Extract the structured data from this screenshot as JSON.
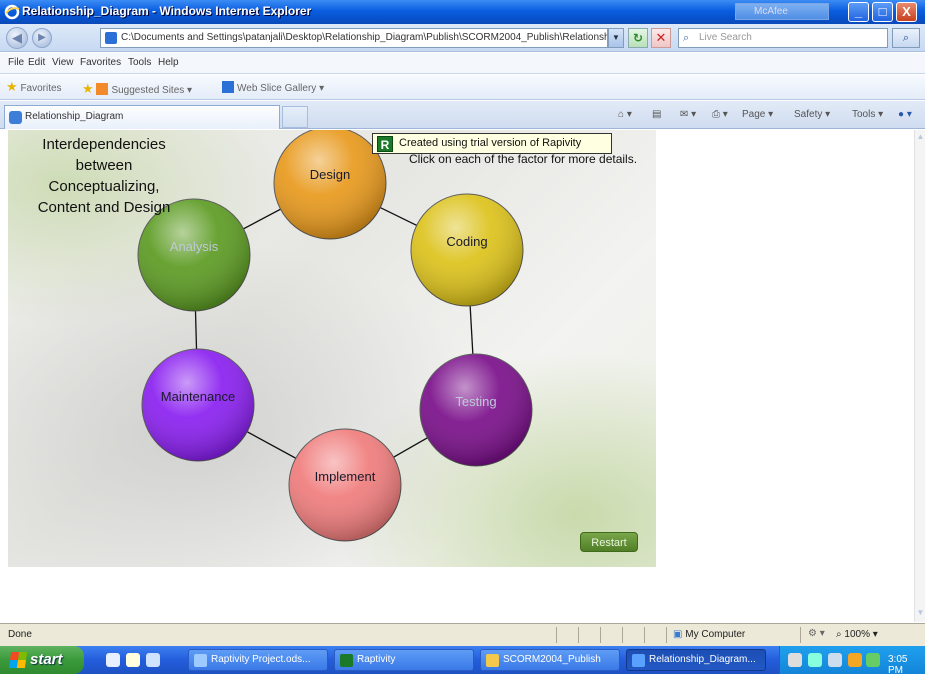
{
  "window": {
    "title": "Relationship_Diagram - Windows Internet Explorer",
    "mcafee": "McAfee",
    "minimize": "_",
    "maximize": "□",
    "close": "X"
  },
  "address_bar": {
    "back": "◀",
    "forward": "▶",
    "url": "C:\\Documents and Settings\\patanjali\\Desktop\\Relationship_Diagram\\Publish\\SCORM2004_Publish\\Relationsh",
    "refresh": "↻",
    "stop": "✕",
    "search_placeholder": "Live Search",
    "search_icon": "⌕"
  },
  "menu": [
    "File",
    "Edit",
    "View",
    "Favorites",
    "Tools",
    "Help"
  ],
  "favorites_bar": {
    "favorites_label": "Favorites",
    "items": [
      "Suggested Sites ▾",
      "Web Slice Gallery ▾"
    ]
  },
  "tab": {
    "label": "Relationship_Diagram",
    "commands": [
      "Page ▾",
      "Safety ▾",
      "Tools ▾"
    ]
  },
  "content": {
    "heading": "Interdependencies between Conceptualizing, Content and Design",
    "hint": "Click on each of the factor for more details.",
    "trial_badge": "R",
    "trial_text": "Created using trial version of Rapivity",
    "restart": "Restart",
    "nodes": [
      {
        "label": "Design",
        "color": "#e8991c"
      },
      {
        "label": "Coding",
        "color": "#dcc21a"
      },
      {
        "label": "Testing",
        "color": "#7a0f8a"
      },
      {
        "label": "Implement",
        "color": "#f07c7c"
      },
      {
        "label": "Maintenance",
        "color": "#8a1ff0"
      },
      {
        "label": "Analysis",
        "color": "#5c9b22"
      }
    ]
  },
  "status_bar": {
    "status": "Done",
    "zone": "My Computer",
    "zoom": "100%"
  },
  "taskbar": {
    "start": "start",
    "buttons": [
      "Raptivity Project.ods...",
      "Raptivity",
      "SCORM2004_Publish",
      "Relationship_Diagram..."
    ],
    "clock": "3:05 PM"
  }
}
